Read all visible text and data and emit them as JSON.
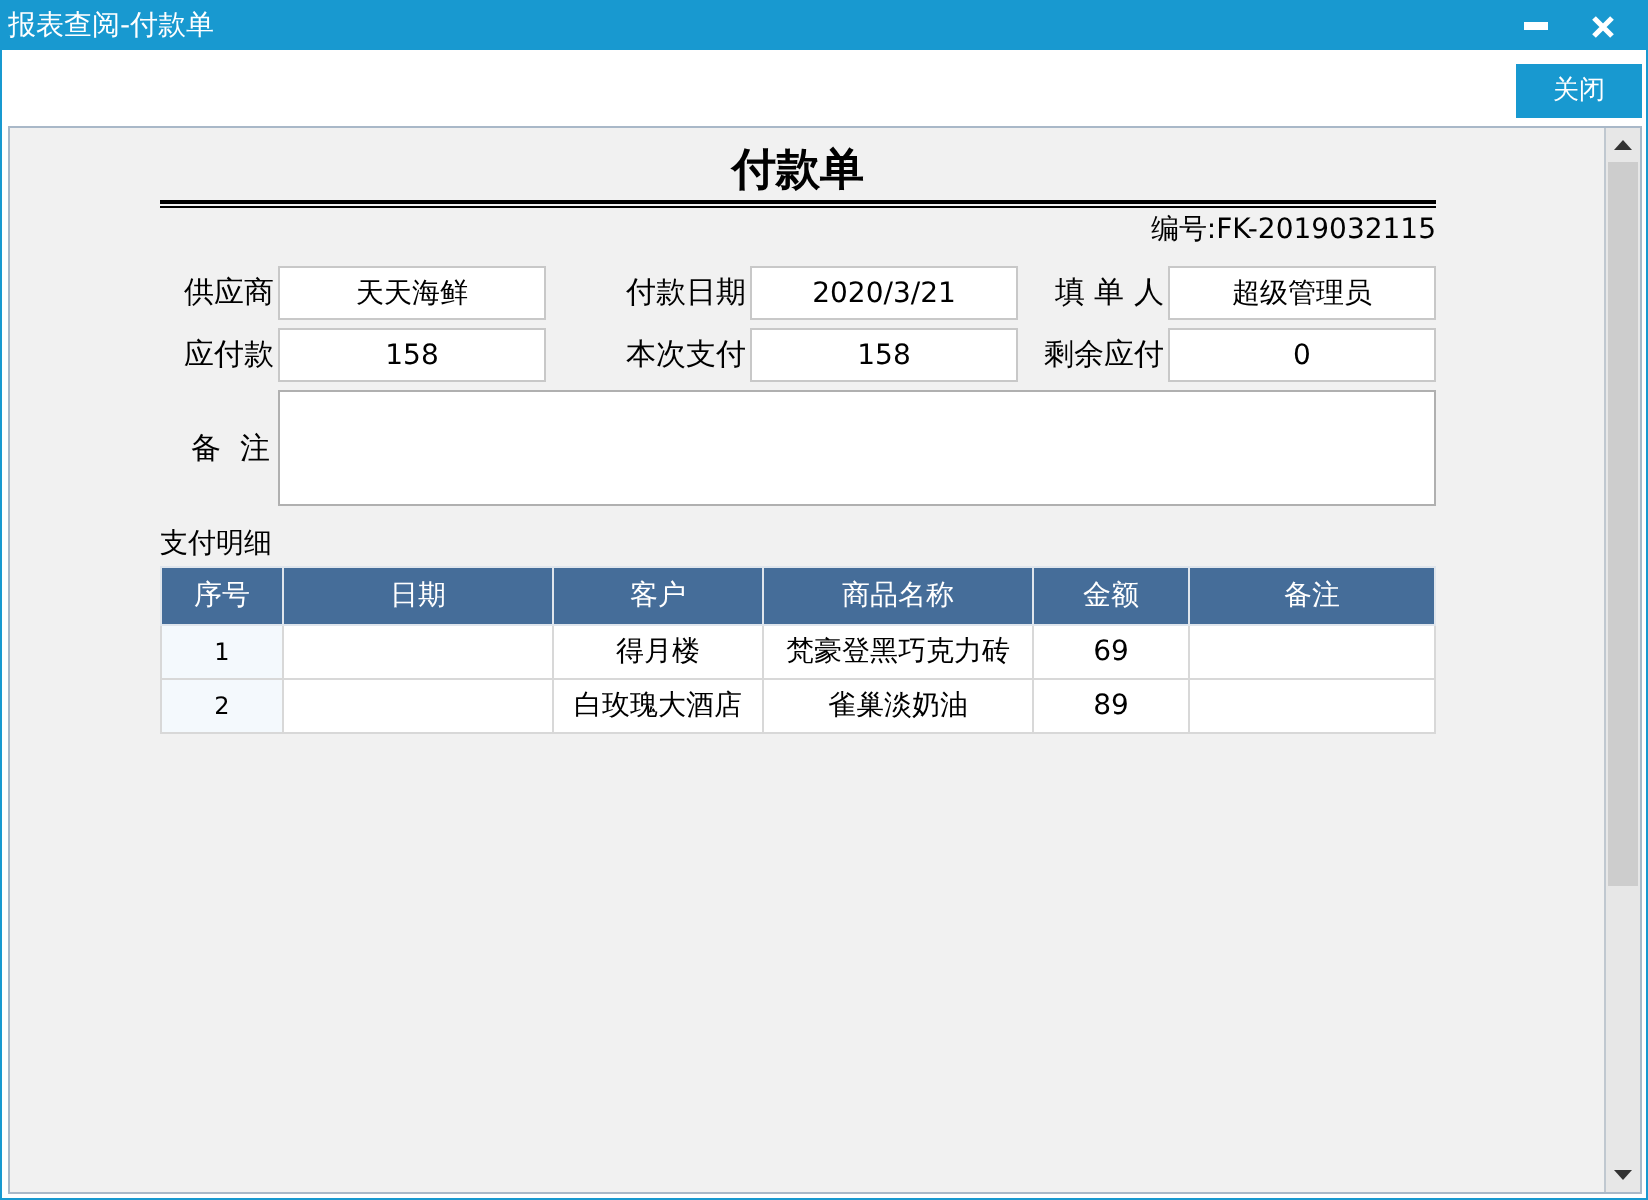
{
  "window": {
    "title": "报表查阅-付款单"
  },
  "toolbar": {
    "buttons": [
      "关闭"
    ]
  },
  "document": {
    "title": "付款单",
    "number": "编号:FK-2019032115",
    "fields": [
      {
        "label": "供应商",
        "value": "天天海鲜"
      },
      {
        "label": "付款日期",
        "value": "2020/3/21"
      },
      {
        "label": "填 单 人",
        "value": "超级管理员"
      },
      {
        "label": "应付款",
        "value": "158"
      },
      {
        "label": "本次支付",
        "value": "158"
      },
      {
        "label": "剩余应付",
        "value": "0"
      }
    ],
    "note": {
      "label": "备  注"
    },
    "detail": {
      "heading": "支付明细",
      "columns": [
        "序号",
        "日期",
        "客户",
        "商品名称",
        "金额",
        "备注"
      ],
      "rows": [
        {
          "cells": [
            "1",
            null,
            "得月楼",
            "梵豪登黑巧克力砖",
            "69",
            null
          ]
        },
        {
          "cells": [
            "2",
            null,
            "白玫瑰大酒店",
            "雀巢淡奶油",
            "89",
            null
          ]
        }
      ]
    }
  }
}
